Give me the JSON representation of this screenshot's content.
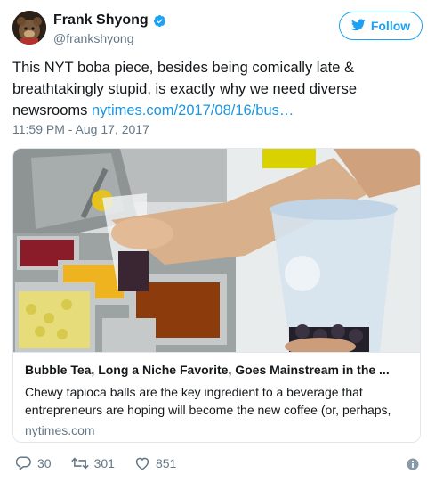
{
  "user": {
    "display_name": "Frank Shyong",
    "handle": "@frankshyong",
    "verified": true
  },
  "follow_button": {
    "label": "Follow"
  },
  "tweet": {
    "text": "This NYT boba piece, besides being comically late & breathtakingly stupid, is exactly why we need diverse newsrooms ",
    "link_text": "nytimes.com/2017/08/16/bus…",
    "timestamp": "11:59 PM - Aug 17, 2017"
  },
  "card": {
    "title": "Bubble Tea, Long a Niche Favorite, Goes Mainstream in the ...",
    "description": "Chewy tapioca balls are the key ingredient to a beverage that entrepreneurs are hoping will become the new coffee (or, perhaps,",
    "domain": "nytimes.com"
  },
  "actions": {
    "replies": "30",
    "retweets": "301",
    "likes": "851"
  },
  "colors": {
    "accent": "#1da1f2",
    "link": "#1b95e0",
    "muted": "#657786",
    "border": "#e1e8ed"
  },
  "icons": [
    "verified-badge-icon",
    "twitter-bird-icon",
    "reply-icon",
    "retweet-icon",
    "like-icon",
    "info-icon"
  ]
}
